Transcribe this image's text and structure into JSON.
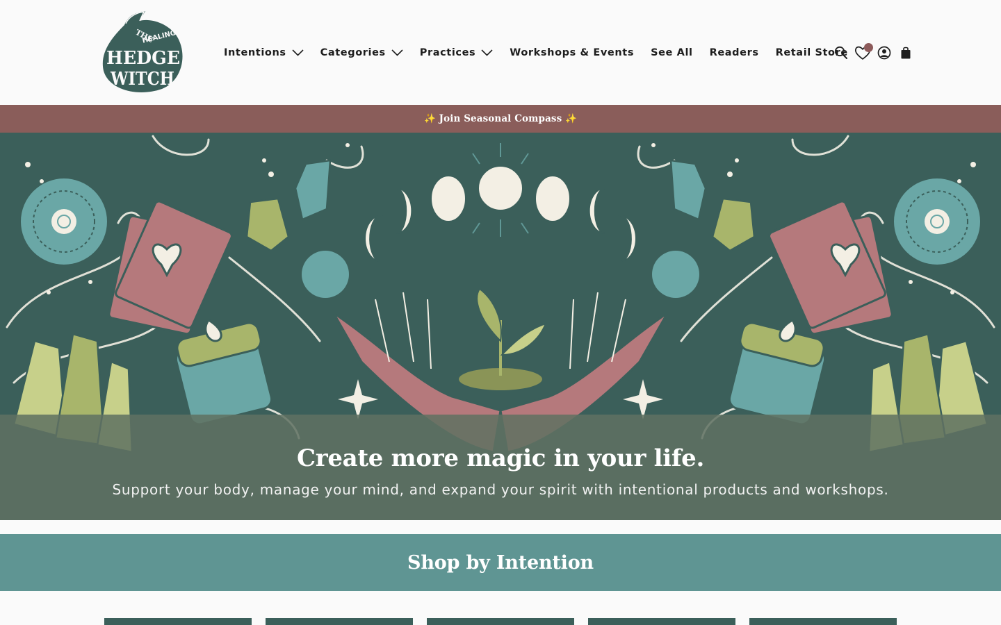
{
  "brand": {
    "logo_text": [
      "THE",
      "HEALING",
      "HEDGE",
      "WITCH"
    ],
    "logo_color": "#3b5f5a"
  },
  "nav": {
    "items": [
      {
        "label": "Intentions",
        "has_dropdown": true
      },
      {
        "label": "Categories",
        "has_dropdown": true
      },
      {
        "label": "Practices",
        "has_dropdown": true
      },
      {
        "label": "Workshops & Events",
        "has_dropdown": false
      },
      {
        "label": "See All",
        "has_dropdown": false
      },
      {
        "label": "Readers",
        "has_dropdown": false
      },
      {
        "label": "Retail Store",
        "has_dropdown": false
      }
    ]
  },
  "header_icons": [
    "search-icon",
    "wishlist-heart-icon",
    "account-icon",
    "cart-bag-icon"
  ],
  "announcement": {
    "text": "✨ Join Seasonal Compass ✨",
    "bg_color": "#8a5d5a"
  },
  "hero": {
    "title": "Create more magic in your life.",
    "subtitle": "Support your body, manage your mind, and expand your spirit with intentional products and workshops.",
    "bg_color": "#3b5f5a"
  },
  "section": {
    "title": "Shop by Intention",
    "bg_color": "#5f9593"
  },
  "colors": {
    "accent_rose": "#8a5d5a",
    "accent_teal": "#5f9593",
    "dark_green": "#3b5f5a",
    "sage": "#a8b56b",
    "pink": "#b5797c"
  }
}
